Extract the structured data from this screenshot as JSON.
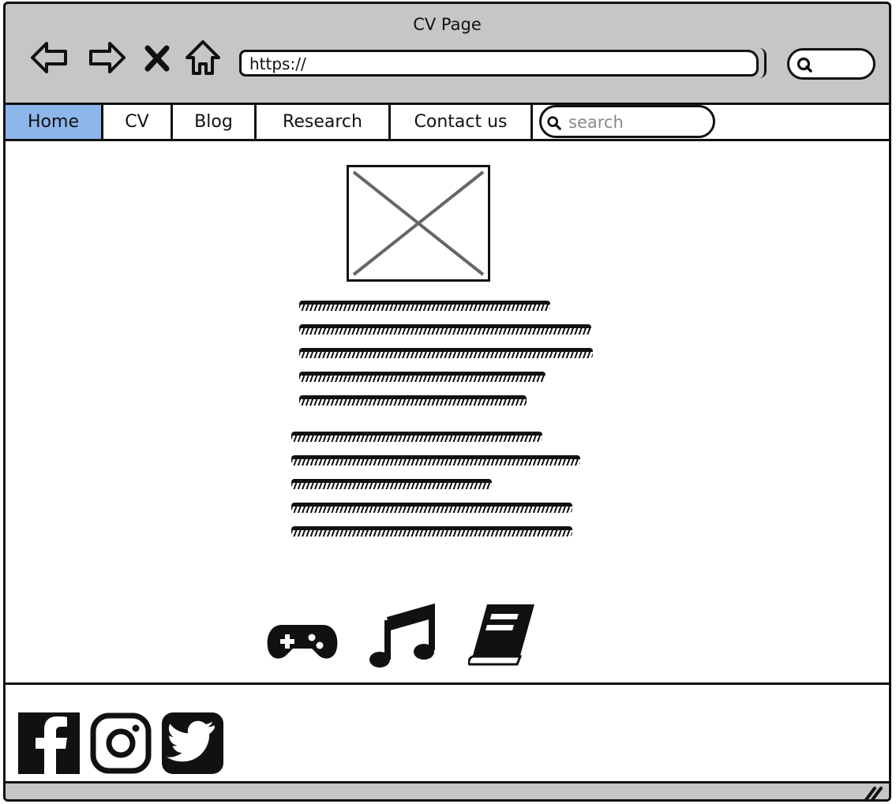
{
  "window": {
    "title": "CV Page"
  },
  "browser": {
    "url": "https://",
    "search_value": ""
  },
  "nav": {
    "items": [
      {
        "label": "Home",
        "active": true
      },
      {
        "label": "CV",
        "active": false
      },
      {
        "label": "Blog",
        "active": false
      },
      {
        "label": "Research",
        "active": false
      },
      {
        "label": "Contact us",
        "active": false
      }
    ],
    "search_placeholder": "search"
  },
  "main": {
    "image": "image-placeholder",
    "hobby_icons": [
      "gamepad-icon",
      "music-note-icon",
      "book-icon"
    ]
  },
  "footer": {
    "social_icons": [
      "facebook-icon",
      "instagram-icon",
      "twitter-icon"
    ]
  },
  "colors": {
    "chrome": "#c6c6c6",
    "active_tab": "#8db6ea",
    "ink": "#111111"
  }
}
